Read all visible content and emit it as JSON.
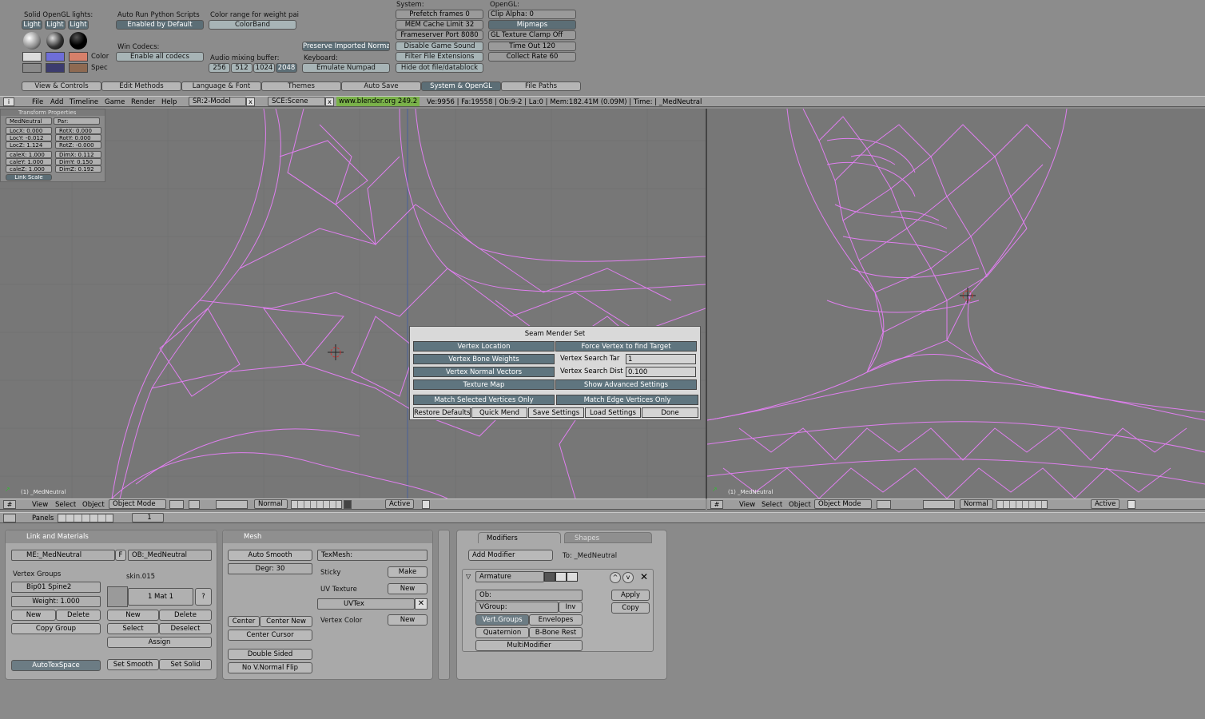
{
  "prefs": {
    "solid_lights_label": "Solid OpenGL lights:",
    "light_buttons": [
      "Light",
      "Light",
      "Light"
    ],
    "color_label": "Color",
    "spec_label": "Spec",
    "auto_run_label": "Auto Run Python Scripts",
    "auto_run_value": "Enabled by Default",
    "win_codecs_label": "Win Codecs:",
    "win_codecs_value": "Enable all codecs",
    "color_range_label": "Color range for weight pai",
    "colorband": "ColorBand",
    "audio_label": "Audio mixing buffer:",
    "audio_options": [
      "256",
      "512",
      "1024",
      "2048"
    ],
    "preserve_normal": "Preserve Imported Normal",
    "keyboard_label": "Keyboard:",
    "emulate_numpad": "Emulate Numpad",
    "system_label": "System:",
    "prefetch": "Prefetch frames 0",
    "mem_cache": "MEM Cache Limit 32",
    "frameserver": "Frameserver Port 8080",
    "disable_sound": "Disable Game Sound",
    "filter_ext": "Filter File Extensions",
    "hide_dot": "Hide dot file/datablock",
    "opengl_label": "OpenGL:",
    "clip_alpha": "Clip Alpha: 0",
    "mipmaps": "Mipmaps",
    "gl_clamp": "GL Texture Clamp Off",
    "timeout": "Time Out 120",
    "collect_rate": "Collect Rate 60",
    "tabs": [
      "View & Controls",
      "Edit Methods",
      "Language & Font",
      "Themes",
      "Auto Save",
      "System & OpenGL",
      "File Paths"
    ]
  },
  "infobar": {
    "menus": [
      "File",
      "Add",
      "Timeline",
      "Game",
      "Render",
      "Help"
    ],
    "screen": "SR:2-Model",
    "scene": "SCE:Scene",
    "url": "www.blender.org 249.2",
    "stats": "Ve:9956 | Fa:19558 | Ob:9-2 | La:0  | Mem:182.41M (0.09M)  | Time: | _MedNeutral"
  },
  "transform": {
    "title": "Transform Properties",
    "name": "MedNeutral",
    "par": "Par:",
    "loc": [
      "LocX: 0.000",
      "LocY: -0.012",
      "LocZ: 1.124"
    ],
    "rot": [
      "RotX: 0.000",
      "RotY: 0.000",
      "RotZ: -0.000"
    ],
    "scale": [
      "caleX: 1.000",
      "caleY: 1.000",
      "caleZ: 1.000"
    ],
    "dim": [
      "DimX: 0.112",
      "DimY: 0.150",
      "DimZ: 0.192"
    ],
    "link_scale": "Link Scale"
  },
  "viewport_left": {
    "label": "(1) _MedNeutral"
  },
  "viewport_right": {
    "label": "(1) _MedNeutral"
  },
  "seam": {
    "title": "Seam Mender Set",
    "vertex_location": "Vertex Location",
    "force_vertex": "Force Vertex to find Target",
    "bone_weights": "Vertex Bone Weights",
    "search_tar_label": "Vertex Search Tar",
    "search_tar_value": "1",
    "normal_vectors": "Vertex Normal Vectors",
    "search_dist_label": "Vertex Search Dist",
    "search_dist_value": "0.100",
    "texture_map": "Texture Map",
    "show_advanced": "Show Advanced Settings",
    "match_selected": "Match Selected Vertices Only",
    "match_edge": "Match Edge Vertices Only",
    "restore": "Restore Defaults",
    "quick_mend": "Quick Mend",
    "save_settings": "Save Settings",
    "load_settings": "Load Settings",
    "done": "Done"
  },
  "view_header": {
    "menus": [
      "View",
      "Select",
      "Object"
    ],
    "mode": "Object Mode",
    "shading": "Normal",
    "active": "Active"
  },
  "buttons_header": {
    "panels": "Panels",
    "frame": "1"
  },
  "link_materials": {
    "title": "Link and Materials",
    "mesh": "ME:_MedNeutral",
    "f": "F",
    "object": "OB:_MedNeutral",
    "vertex_groups": "Vertex Groups",
    "material_name": "skin.015",
    "group": "Bip01 Spine2",
    "weight": "Weight: 1.000",
    "mat": "1 Mat 1",
    "question": "?",
    "new": "New",
    "delete": "Delete",
    "copy_group": "Copy Group",
    "select": "Select",
    "deselect": "Deselect",
    "assign": "Assign",
    "autotex": "AutoTexSpace",
    "set_smooth": "Set Smooth",
    "set_solid": "Set Solid"
  },
  "mesh": {
    "title": "Mesh",
    "auto_smooth": "Auto Smooth",
    "degr": "Degr: 30",
    "texmesh": "TexMesh:",
    "sticky": "Sticky",
    "make": "Make",
    "uv_texture": "UV Texture",
    "new": "New",
    "uvtex": "UVTex",
    "vertex_color": "Vertex Color",
    "center": "Center",
    "center_new": "Center New",
    "center_cursor": "Center Cursor",
    "double_sided": "Double Sided",
    "no_vnormal": "No V.Normal Flip"
  },
  "modifiers": {
    "tab_modifiers": "Modifiers",
    "tab_shapes": "Shapes",
    "add_modifier": "Add Modifier",
    "to": "To: _MedNeutral",
    "name": "Armature",
    "apply": "Apply",
    "copy": "Copy",
    "ob": "Ob:",
    "vgroup": "VGroup:",
    "inv": "Inv",
    "vert_groups": "Vert.Groups",
    "envelopes": "Envelopes",
    "quaternion": "Quaternion",
    "bbone": "B-Bone Rest",
    "multimodifier": "MultiModifier"
  },
  "colors": {
    "wire": "#e07ff0",
    "viewport": "#767676",
    "accent_green": "#7ab24a"
  }
}
